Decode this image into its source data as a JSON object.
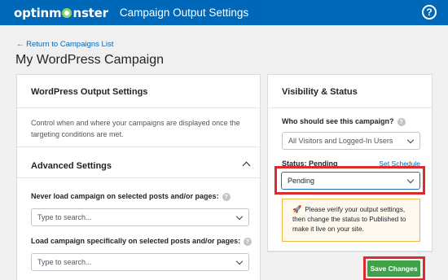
{
  "topbar": {
    "logo_part1": "optinm",
    "logo_part2": "nster",
    "title": "Campaign Output Settings",
    "help_label": "?"
  },
  "back_link": "← Return to Campaigns List",
  "page_title": "My WordPress Campaign",
  "left_panel": {
    "title": "WordPress Output Settings",
    "description": "Control when and where your campaigns are displayed once the targeting conditions are met.",
    "advanced_title": "Advanced Settings",
    "never_load_label": "Never load campaign on selected posts and/or pages:",
    "never_load_placeholder": "Type to search...",
    "load_specific_label": "Load campaign specifically on selected posts and/or pages:",
    "load_specific_placeholder": "Type to search..."
  },
  "right_panel": {
    "title": "Visibility & Status",
    "who_label": "Who should see this campaign?",
    "who_value": "All Visitors and Logged-In Users",
    "status_label": "Status: Pending",
    "set_schedule": "Set Schedule",
    "status_value": "Pending",
    "notice_text": "Please verify your output settings, then change the status to Published to make it live on your site."
  },
  "save_button": "Save Changes",
  "colors": {
    "topbar": "#0068b8",
    "link": "#0068b8",
    "highlight": "#dd2b2b",
    "save": "#3fa14a",
    "notice_bg": "#fef8ee"
  }
}
